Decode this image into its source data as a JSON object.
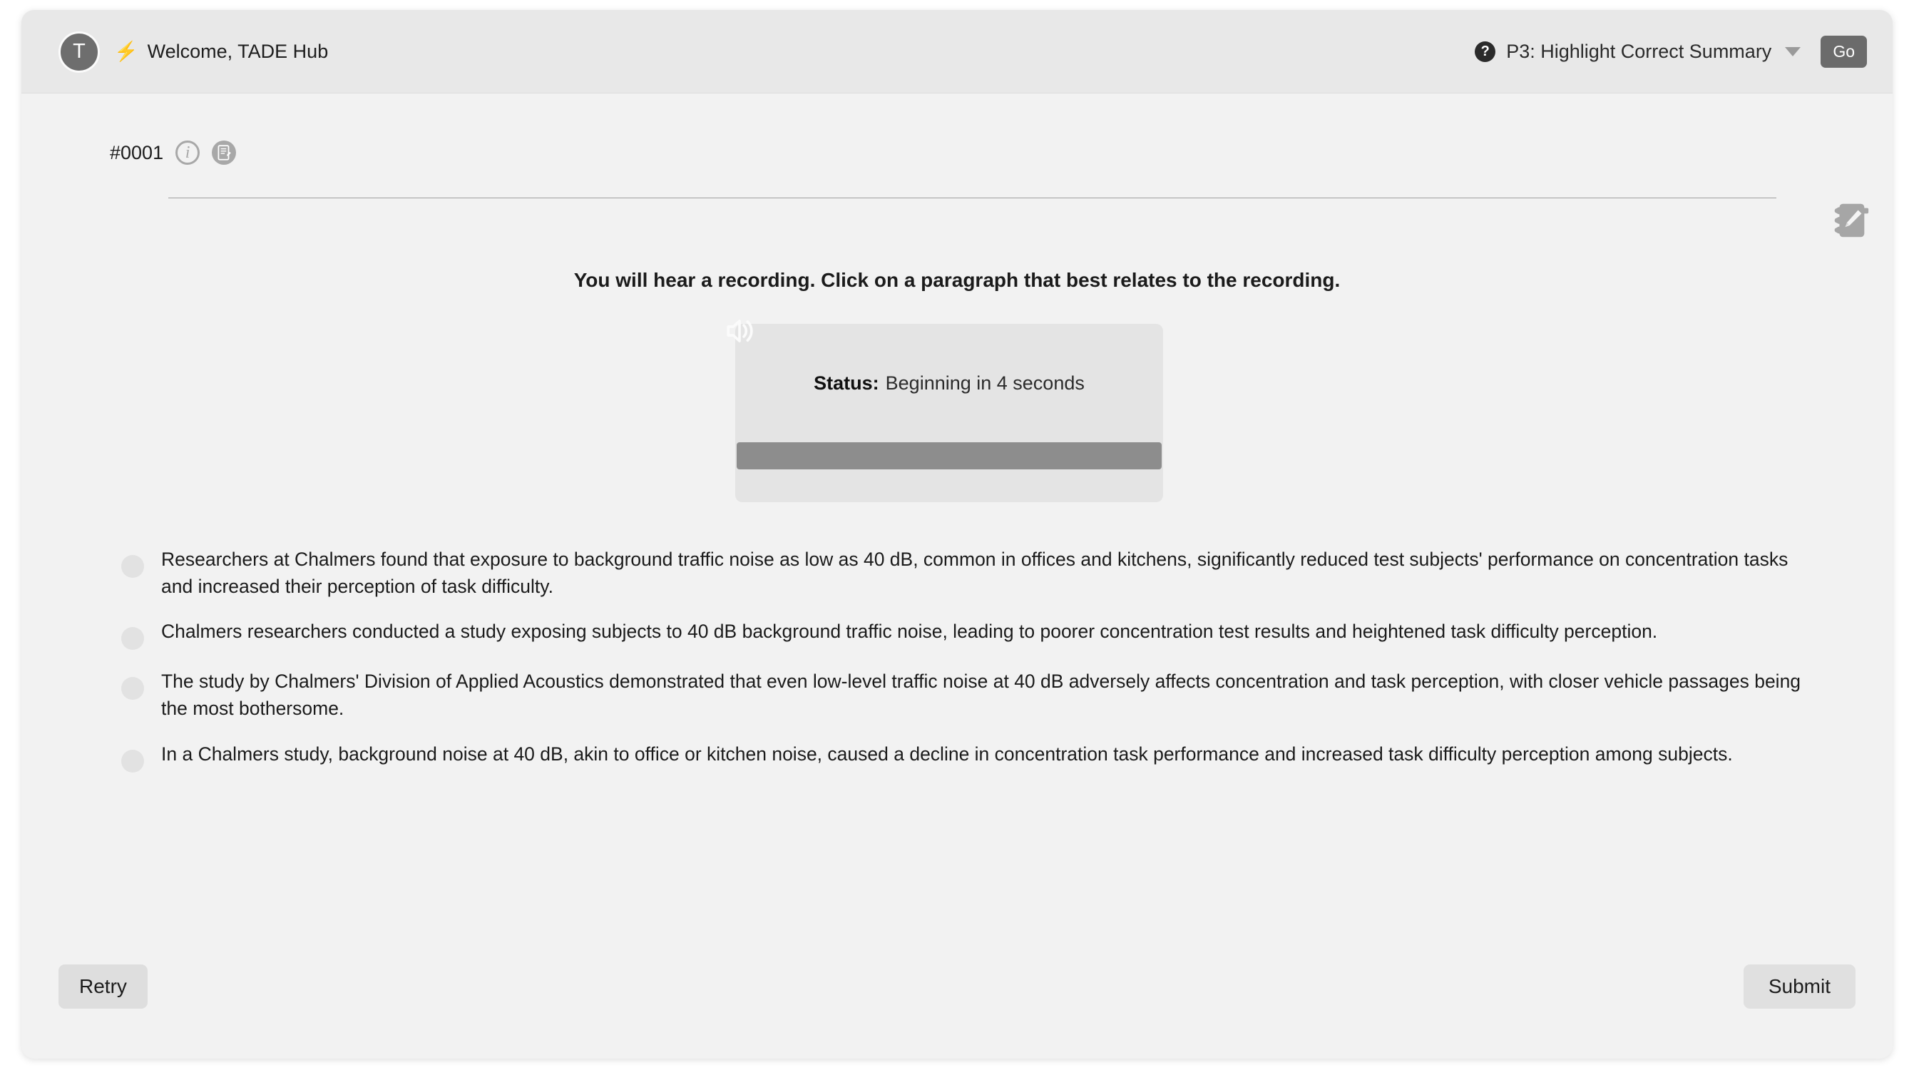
{
  "header": {
    "avatar_initial": "T",
    "bolt_icon": "bolt-icon",
    "welcome_text": "Welcome, TADE Hub",
    "help_icon_glyph": "?",
    "task_label": "P3: Highlight Correct Summary",
    "go_label": "Go"
  },
  "item": {
    "id_label": "#0001",
    "info_icon": "info-icon",
    "note_icon": "note-edit-icon",
    "notebook_icon": "notebook-pencil-icon"
  },
  "prompt": "You will hear a recording. Click on a paragraph that best relates to the recording.",
  "audio": {
    "speaker_icon": "speaker-icon",
    "status_label": "Status:",
    "status_value": "Beginning in 4 seconds",
    "progress_percent": 100
  },
  "options": [
    "Researchers at Chalmers found that exposure to background traffic noise as low as 40 dB, common in offices and kitchens, significantly reduced test subjects' performance on concentration tasks and increased their perception of task difficulty.",
    "Chalmers researchers conducted a study exposing subjects to 40 dB background traffic noise, leading to poorer concentration test results and heightened task difficulty perception.",
    "The study by Chalmers' Division of Applied Acoustics demonstrated that even low-level traffic noise at 40 dB adversely affects concentration and task perception, with closer vehicle passages being the most bothersome.",
    "In a Chalmers study, background noise at 40 dB, akin to office or kitchen noise, caused a decline in concentration task performance and increased task difficulty perception among subjects."
  ],
  "footer": {
    "retry_label": "Retry",
    "submit_label": "Submit"
  },
  "colors": {
    "page_background": "#ffffff",
    "card_background": "#f2f2f2",
    "topbar_background": "#e8e8e8",
    "accent_dark": "#6b6b6b",
    "progress_fill": "#8d8d8d",
    "bullet": "#e2e2e2"
  }
}
